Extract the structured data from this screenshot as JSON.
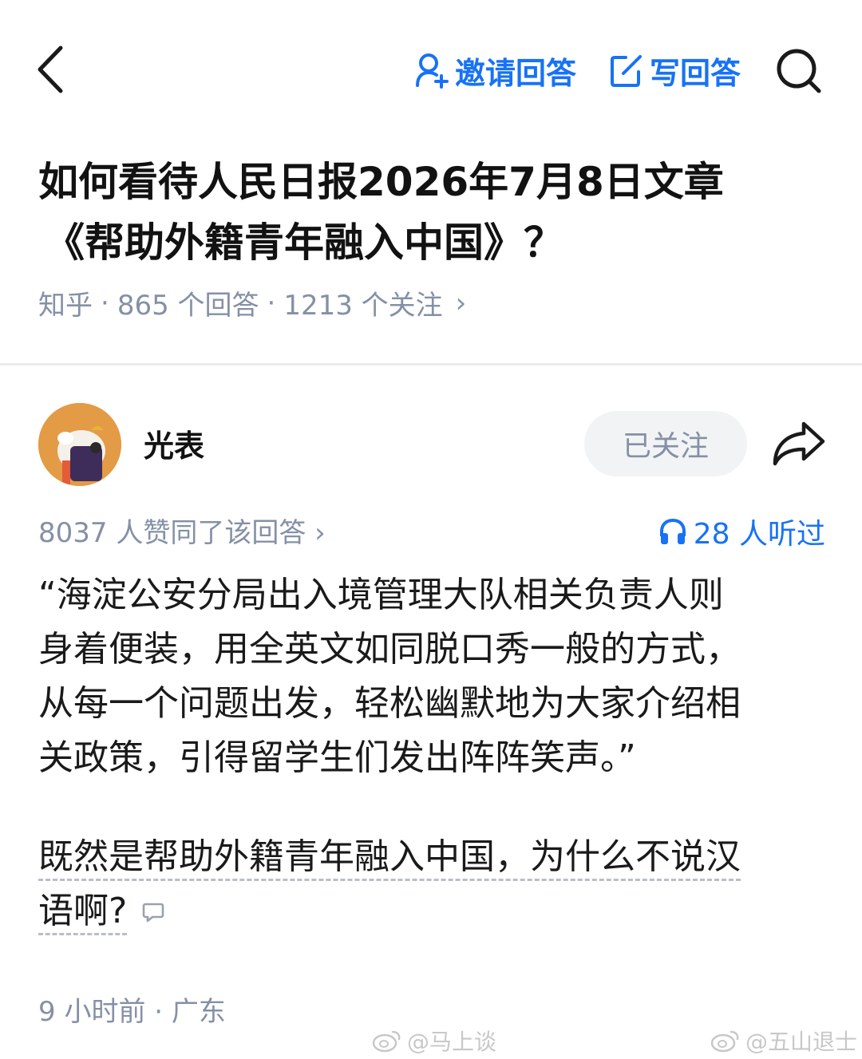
{
  "topbar": {
    "back_icon": "chevron-left-icon",
    "invite_label": "邀请回答",
    "write_label": "写回答",
    "accent": "#1772f6"
  },
  "question": {
    "title_line1": "如何看待人民日报2026年7月8日文章",
    "title_line2": "《帮助外籍青年融入中国》？",
    "meta_source": "知乎",
    "meta_sep": "·",
    "meta_answers": "865 个回答",
    "meta_follows": "1213 个关注",
    "meta_chevron": "›"
  },
  "author": {
    "name": "光表",
    "follow_label": "已关注"
  },
  "stats": {
    "votes": "8037 人赞同了该回答 ›",
    "listens": "28 人听过"
  },
  "answer": {
    "p1_lines": [
      "“海淀公安分局出入境管理大队相关负责人则",
      "身着便装，用全英文如同脱口秀一般的方式，",
      "从每一个问题出发，轻松幽默地为大家介绍相",
      "关政策，引得留学生们发出阵阵笑声。”"
    ],
    "p2_line1": "既然是帮助外籍青年融入中国，为什么不说汉",
    "p2_line2": "语啊?",
    "time": "9 小时前 · 广东"
  },
  "watermarks": {
    "left": "@马上谈",
    "right": "@五山退士"
  }
}
